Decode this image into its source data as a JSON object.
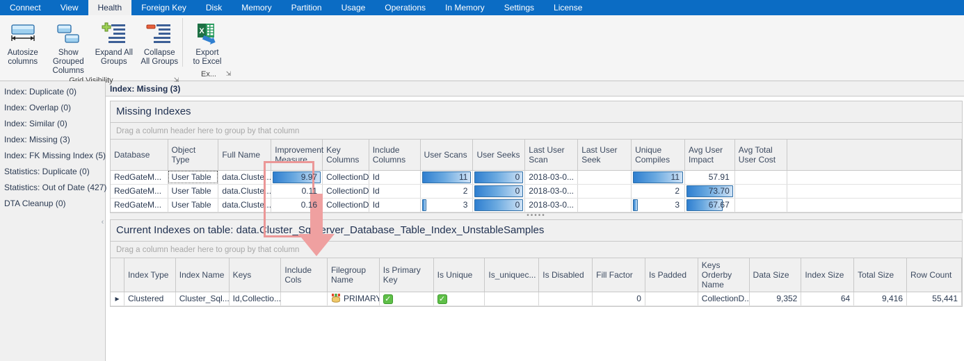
{
  "tabs": [
    {
      "label": "Connect",
      "active": false
    },
    {
      "label": "View",
      "active": false
    },
    {
      "label": "Health",
      "active": true
    },
    {
      "label": "Foreign Key",
      "active": false
    },
    {
      "label": "Disk",
      "active": false
    },
    {
      "label": "Memory",
      "active": false
    },
    {
      "label": "Partition",
      "active": false
    },
    {
      "label": "Usage",
      "active": false
    },
    {
      "label": "Operations",
      "active": false
    },
    {
      "label": "In Memory",
      "active": false
    },
    {
      "label": "Settings",
      "active": false
    },
    {
      "label": "License",
      "active": false
    }
  ],
  "ribbon": {
    "groups": [
      {
        "title": "Grid Visibility",
        "buttons": [
          {
            "label": "Autosize\ncolumns",
            "icon": "autosize-columns-icon"
          },
          {
            "label": "Show Grouped\nColumns",
            "icon": "grouped-columns-icon"
          },
          {
            "label": "Expand All\nGroups",
            "icon": "expand-groups-icon"
          },
          {
            "label": "Collapse\nAll Groups",
            "icon": "collapse-groups-icon"
          }
        ]
      },
      {
        "title": "Ex...",
        "buttons": [
          {
            "label": "Export\nto Excel",
            "icon": "export-excel-icon"
          }
        ]
      }
    ],
    "launcher_glyph": "⤵"
  },
  "sidebar": {
    "items": [
      {
        "label": "Index: Duplicate (0)"
      },
      {
        "label": "Index: Overlap (0)"
      },
      {
        "label": "Index: Similar (0)"
      },
      {
        "label": "Index: Missing (3)"
      },
      {
        "label": "Index: FK Missing Index (5)"
      },
      {
        "label": "Statistics: Duplicate (0)"
      },
      {
        "label": "Statistics: Out of Date (427)"
      },
      {
        "label": "DTA Cleanup (0)"
      }
    ],
    "collapse_glyph": "‹"
  },
  "content": {
    "title": "Index: Missing (3)"
  },
  "missing_grid": {
    "caption": "Missing Indexes",
    "group_hint": "Drag a column header here to group by that column",
    "columns": [
      "Database",
      "Object Type",
      "Full Name",
      "Improvement\nMeasure",
      "Key Columns",
      "Include\nColumns",
      "User Scans",
      "User Seeks",
      "Last User\nScan",
      "Last User\nSeek",
      "Unique\nCompiles",
      "Avg User\nImpact",
      "Avg Total\nUser Cost",
      ""
    ],
    "rows": [
      {
        "database": "RedGateM...",
        "object_type": "User Table",
        "full_name": "data.Cluste...",
        "improvement_measure": "9.97",
        "improvement_bar_pct": 100,
        "key_columns": "CollectionD...",
        "include_columns": "Id",
        "user_scans": "11",
        "user_scans_bar_pct": 100,
        "user_seeks": "0",
        "user_seeks_bar_pct": 100,
        "last_user_scan": "2018-03-0...",
        "last_user_seek": "",
        "unique_compiles": "11",
        "unique_compiles_bar_pct": 100,
        "avg_user_impact": "57.91",
        "avg_user_impact_bar_pct": 0,
        "avg_total_user_cost": ""
      },
      {
        "database": "RedGateM...",
        "object_type": "User Table",
        "full_name": "data.Cluste...",
        "improvement_measure": "0.11",
        "improvement_bar_pct": 0,
        "key_columns": "CollectionD...",
        "include_columns": "Id",
        "user_scans": "2",
        "user_scans_bar_pct": 0,
        "user_seeks": "0",
        "user_seeks_bar_pct": 100,
        "last_user_scan": "2018-03-0...",
        "last_user_seek": "",
        "unique_compiles": "2",
        "unique_compiles_bar_pct": 0,
        "avg_user_impact": "73.70",
        "avg_user_impact_bar_pct": 100,
        "avg_total_user_cost": ""
      },
      {
        "database": "RedGateM...",
        "object_type": "User Table",
        "full_name": "data.Cluste...",
        "improvement_measure": "0.16",
        "improvement_bar_pct": 0,
        "key_columns": "CollectionD...",
        "include_columns": "Id",
        "user_scans": "3",
        "user_scans_bar_pct": 9,
        "user_seeks": "0",
        "user_seeks_bar_pct": 100,
        "last_user_scan": "2018-03-0...",
        "last_user_seek": "",
        "unique_compiles": "3",
        "unique_compiles_bar_pct": 9,
        "avg_user_impact": "67.67",
        "avg_user_impact_bar_pct": 78,
        "avg_total_user_cost": ""
      }
    ]
  },
  "splitter": {
    "dots": "•••••"
  },
  "current_grid": {
    "caption": "Current Indexes on table: data.Cluster_SqlServer_Database_Table_Index_UnstableSamples",
    "group_hint": "Drag a column header here to group by that column",
    "columns": [
      "",
      "Index Type",
      "Index Name",
      "Keys",
      "Include Cols",
      "Filegroup\nName",
      "Is Primary\nKey",
      "Is Unique",
      "Is_uniquec...",
      "Is Disabled",
      "Fill Factor",
      "Is Padded",
      "Keys Orderby\nName",
      "Data Size",
      "Index Size",
      "Total Size",
      "Row Count"
    ],
    "rows": [
      {
        "expander": "▸",
        "index_type": "Clustered",
        "index_name": "Cluster_Sql...",
        "keys": "Id,Collectio...",
        "include_cols": "",
        "filegroup_name": "PRIMARY",
        "is_primary_key": "✓",
        "is_unique": "✓",
        "is_uniquec": "",
        "is_disabled": "",
        "fill_factor": "0",
        "is_padded": "",
        "keys_orderby_name": "CollectionD...",
        "data_size": "9,352",
        "index_size": "64",
        "total_size": "9,416",
        "row_count": "55,441"
      }
    ]
  },
  "annotation": {
    "highlight_color": "#eb9797",
    "arrow_color": "#efa0a0"
  }
}
